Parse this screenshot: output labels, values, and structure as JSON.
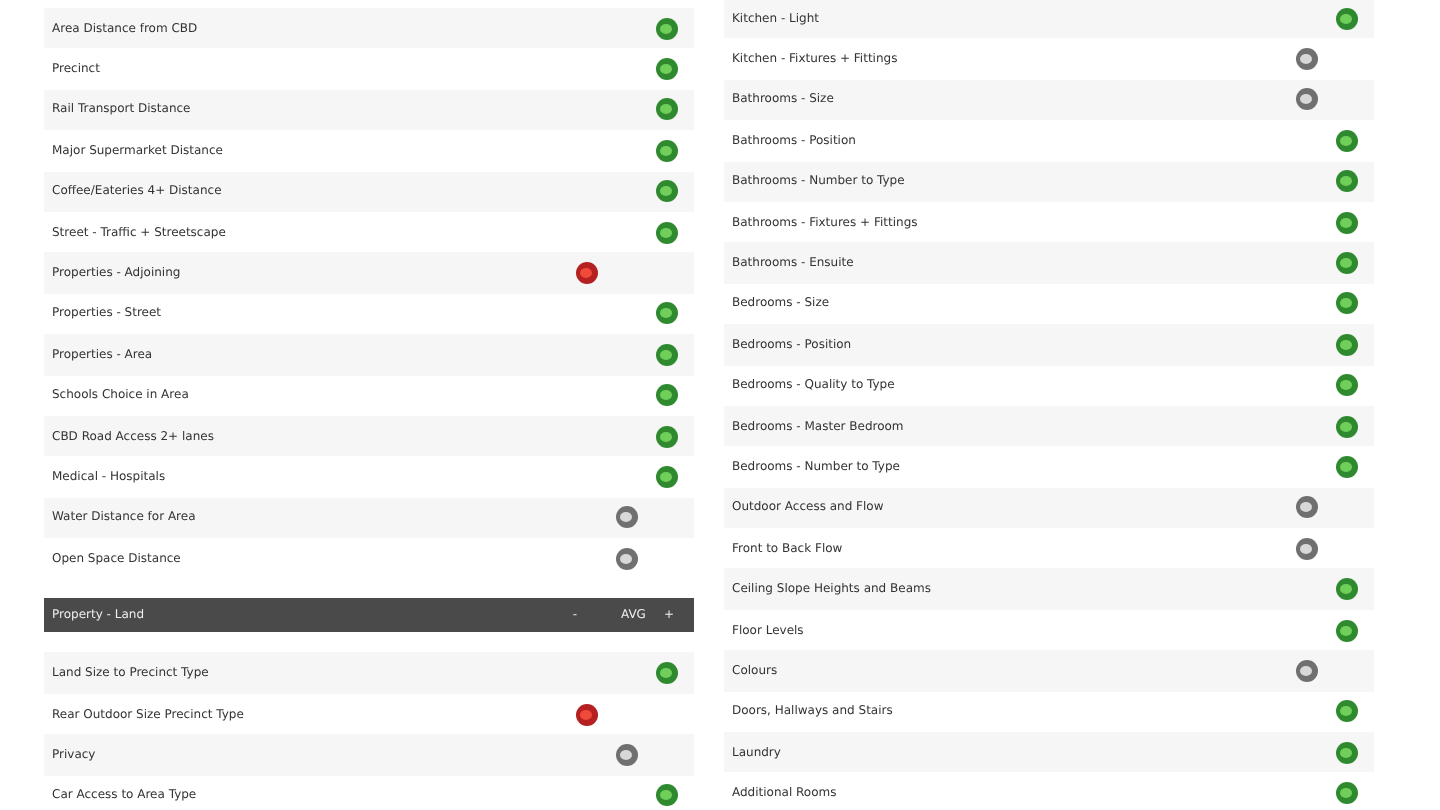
{
  "left_column": {
    "items": [
      {
        "label": "Area Distance from CBD",
        "kind": "good"
      },
      {
        "label": "Precinct",
        "kind": "good"
      },
      {
        "label": "Rail Transport Distance",
        "kind": "good"
      },
      {
        "label": "Major Supermarket Distance",
        "kind": "good"
      },
      {
        "label": "Coffee/Eateries 4+ Distance",
        "kind": "good"
      },
      {
        "label": "Street - Traffic + Streetscape",
        "kind": "good"
      },
      {
        "label": "Properties - Adjoining",
        "kind": "poor"
      },
      {
        "label": "Properties - Street",
        "kind": "good"
      },
      {
        "label": "Properties - Area",
        "kind": "good"
      },
      {
        "label": "Schools Choice in Area",
        "kind": "good"
      },
      {
        "label": "CBD Road Access 2+ lanes",
        "kind": "good"
      },
      {
        "label": "Medical - Hospitals",
        "kind": "good"
      },
      {
        "label": "Water Distance for Area",
        "kind": "neutral"
      },
      {
        "label": "Open Space Distance",
        "kind": "neutral"
      }
    ],
    "section_header": {
      "title": "Property - Land",
      "minus": "-",
      "avg": "AVG",
      "plus": "+"
    },
    "section_items": [
      {
        "label": "Land Size to Precinct Type",
        "kind": "good"
      },
      {
        "label": "Rear Outdoor Size Precinct Type",
        "kind": "poor"
      },
      {
        "label": "Privacy",
        "kind": "neutral"
      },
      {
        "label": "Car Access to Area Type",
        "kind": "good"
      }
    ]
  },
  "right_column": {
    "items": [
      {
        "label": "Kitchen - Light",
        "kind": "good"
      },
      {
        "label": "Kitchen - Fixtures + Fittings",
        "kind": "neutral"
      },
      {
        "label": "Bathrooms - Size",
        "kind": "neutral"
      },
      {
        "label": "Bathrooms - Position",
        "kind": "good"
      },
      {
        "label": "Bathrooms - Number to Type",
        "kind": "good"
      },
      {
        "label": "Bathrooms - Fixtures + Fittings",
        "kind": "good"
      },
      {
        "label": "Bathrooms - Ensuite",
        "kind": "good"
      },
      {
        "label": "Bedrooms - Size",
        "kind": "good"
      },
      {
        "label": "Bedrooms - Position",
        "kind": "good"
      },
      {
        "label": "Bedrooms - Quality to Type",
        "kind": "good"
      },
      {
        "label": "Bedrooms - Master Bedroom",
        "kind": "good"
      },
      {
        "label": "Bedrooms - Number to Type",
        "kind": "good"
      },
      {
        "label": "Outdoor Access and Flow",
        "kind": "neutral"
      },
      {
        "label": "Front to Back Flow",
        "kind": "neutral"
      },
      {
        "label": "Ceiling Slope Heights and Beams",
        "kind": "good"
      },
      {
        "label": "Floor Levels",
        "kind": "good"
      },
      {
        "label": "Colours",
        "kind": "neutral"
      },
      {
        "label": "Doors, Hallways and Stairs",
        "kind": "good"
      },
      {
        "label": "Laundry",
        "kind": "good"
      },
      {
        "label": "Additional Rooms",
        "kind": "good"
      }
    ]
  }
}
